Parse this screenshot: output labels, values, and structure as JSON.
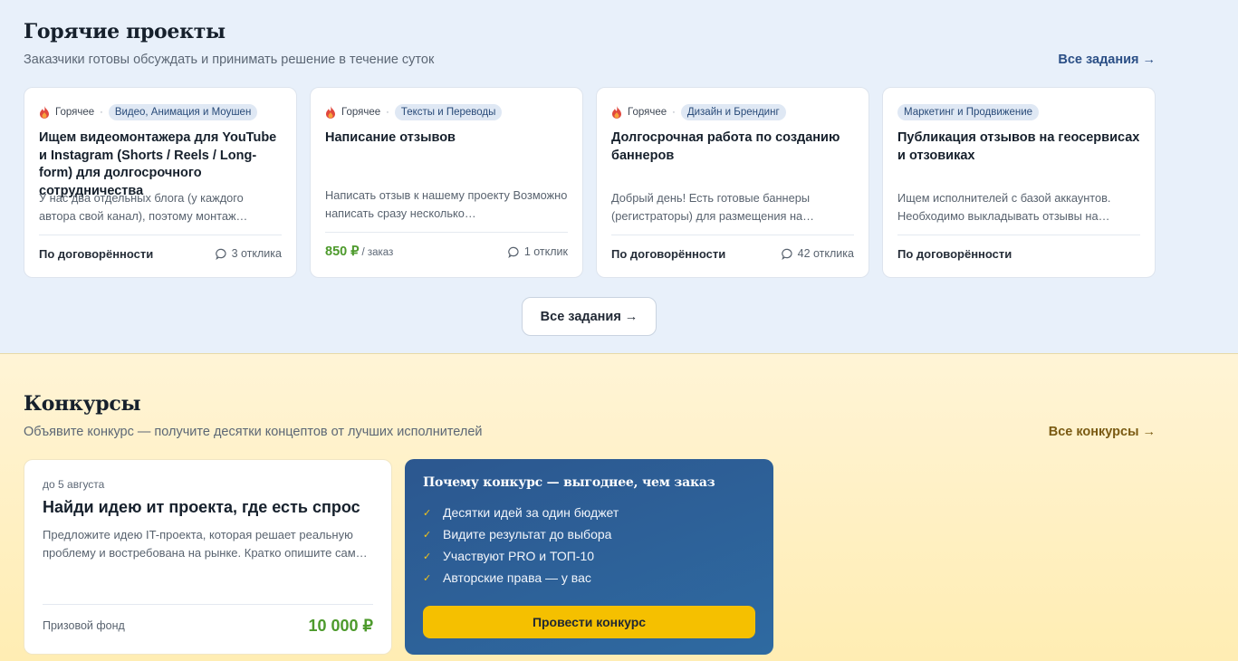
{
  "hot": {
    "title": "Горячие проекты",
    "subtitle": "Заказчики готовы обсуждать и принимать решение в течение суток",
    "all_link": "Все задания →",
    "all_button": "Все задания →",
    "accent_color": "#2b4f86",
    "cards": [
      {
        "hot_label": "Горячее",
        "category": "Видео, Анимация и Моушен",
        "title": "Ищем видеомонтажера для YouTube и Instagram (Shorts / Reels / Long-form) для долгосрочного сотрудничества",
        "desc": "У нас два отдельных блога (у каждого автора свой канал), поэтому монтаж…",
        "price": "По договорённости",
        "responses": "3 отклика"
      },
      {
        "hot_label": "Горячее",
        "category": "Тексты и Переводы",
        "title": "Написание отзывов",
        "desc": "Написать отзыв к нашему проекту Возможно написать сразу несколько…",
        "price_value": "850 ₽",
        "price_unit": "/ заказ",
        "responses": "1 отклик"
      },
      {
        "hot_label": "Горячее",
        "category": "Дизайн и Брендинг",
        "title": "Долгосрочная работа по созданию баннеров",
        "desc": "Добрый день! Есть готовые баннеры (регистраторы) для размещения на…",
        "price": "По договорённости",
        "responses": "42 отклика"
      },
      {
        "category": "Маркетинг и Продвижение",
        "title": "Публикация отзывов на геосервисах и отзовиках",
        "desc": "Ищем исполнителей с базой аккаунтов. Необходимо выкладывать отзывы на…",
        "price": "По договорённости"
      }
    ]
  },
  "contests": {
    "title": "Конкурсы",
    "subtitle": "Объявите конкурс — получите десятки концептов от лучших исполнителей",
    "all_link": "Все конкурсы →",
    "link_color": "#7a5a12",
    "card": {
      "deadline": "до 5 августа",
      "title": "Найди идею ит проекта, где есть спрос",
      "desc": "Предложите идею IT-проекта, которая решает реальную проблему и востребована на рынке. Кратко опишите сам…",
      "fund_label": "Призовой фонд",
      "fund_value": "10 000 ₽"
    },
    "why": {
      "title": "Почему конкурс — выгоднее, чем заказ",
      "items": [
        "Десятки идей за один бюджет",
        "Видите результат до выбора",
        "Участвуют PRO и ТОП-10",
        "Авторские права — у вас"
      ],
      "cta": "Провести конкурс"
    }
  }
}
